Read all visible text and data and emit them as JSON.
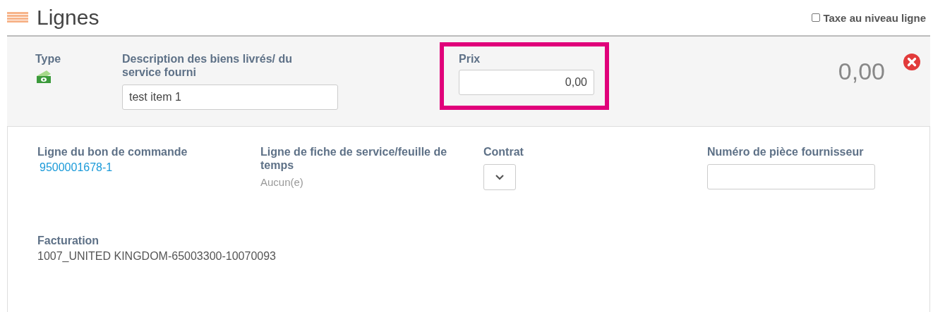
{
  "section": {
    "title": "Lignes"
  },
  "line_tax": {
    "label": "Taxe au niveau ligne",
    "checked": false
  },
  "line": {
    "type_label": "Type",
    "description": {
      "label": "Description des biens livrés/ du service fourni",
      "value": "test item 1"
    },
    "price": {
      "label": "Prix",
      "value": "0,00",
      "highlighted": true
    },
    "total": "0,00"
  },
  "details": [
    {
      "kind": "link",
      "label": "Ligne du bon de commande",
      "value": "9500001678-1"
    },
    {
      "kind": "text",
      "label": "Ligne de fiche de service/feuille de temps",
      "value": "Aucun(e)"
    },
    {
      "kind": "select",
      "label": "Contrat"
    },
    {
      "kind": "input",
      "label": "Numéro de pièce fournisseur"
    }
  ],
  "billing": {
    "label": "Facturation",
    "value": "1007_UNITED KINGDOM-65003300-10070093"
  }
}
